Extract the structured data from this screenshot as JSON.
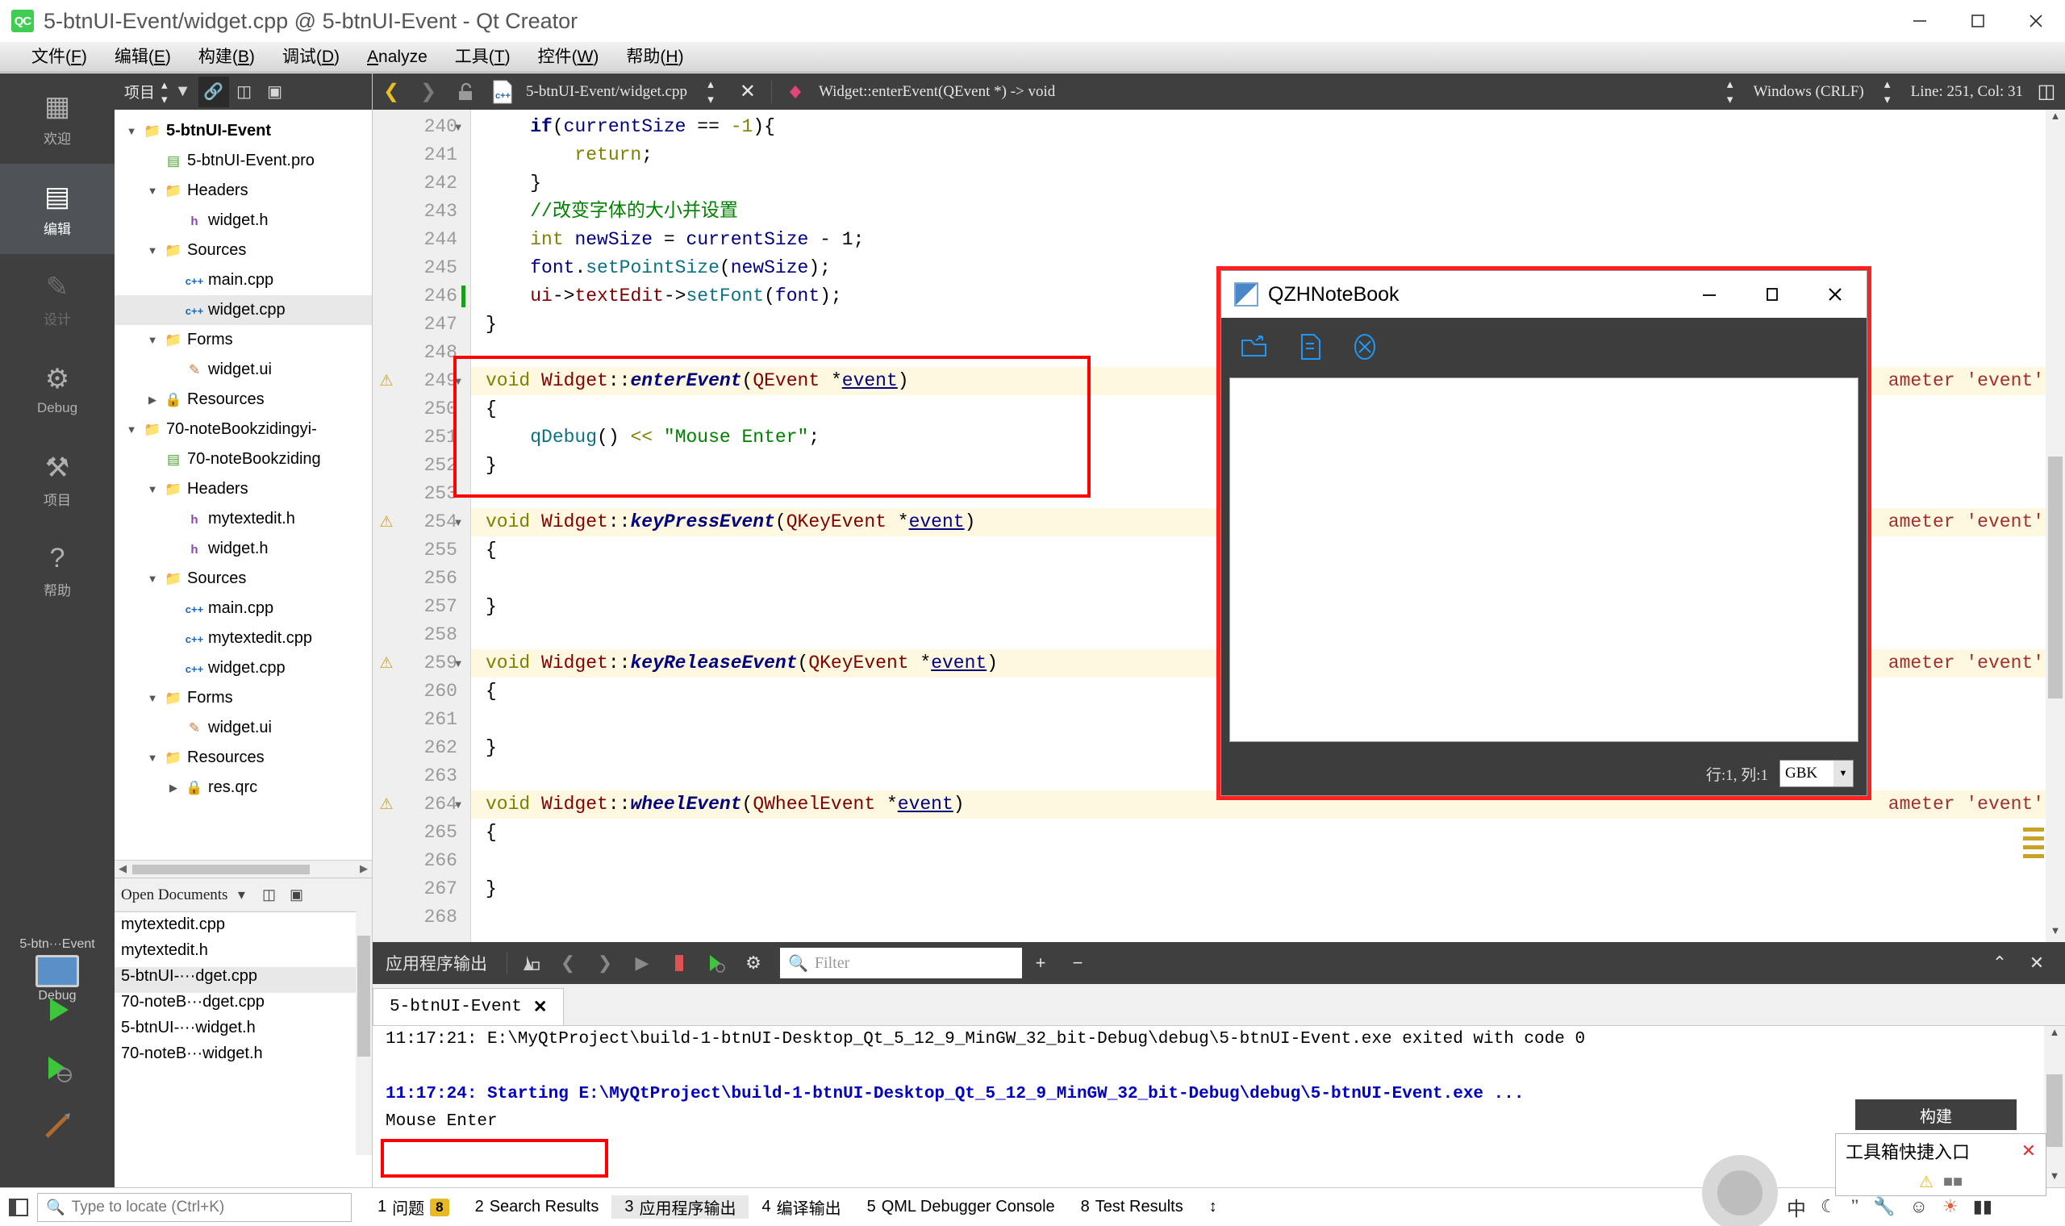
{
  "window": {
    "title": "5-btnUI-Event/widget.cpp @ 5-btnUI-Event - Qt Creator",
    "icon_text": "QC",
    "minimize": "—",
    "maximize": "❐",
    "close": "✕"
  },
  "menubar": {
    "items": [
      {
        "label": "文件(F)"
      },
      {
        "label": "编辑(E)"
      },
      {
        "label": "构建(B)"
      },
      {
        "label": "调试(D)"
      },
      {
        "label": "Analyze"
      },
      {
        "label": "工具(T)"
      },
      {
        "label": "控件(W)"
      },
      {
        "label": "帮助(H)"
      }
    ]
  },
  "modebar": {
    "items": [
      {
        "label": "欢迎",
        "icon": "grid-icon",
        "glyph": "▦",
        "active": false,
        "dim": false
      },
      {
        "label": "编辑",
        "icon": "document-icon",
        "glyph": "▤",
        "active": true,
        "dim": false
      },
      {
        "label": "设计",
        "icon": "pencil-icon",
        "glyph": "✎",
        "active": false,
        "dim": true
      },
      {
        "label": "Debug",
        "icon": "bug-icon",
        "glyph": "⚙",
        "active": false,
        "dim": false
      },
      {
        "label": "项目",
        "icon": "wrench-icon",
        "glyph": "⚒",
        "active": false,
        "dim": false
      },
      {
        "label": "帮助",
        "icon": "help-icon",
        "glyph": "?",
        "active": false,
        "dim": false
      }
    ],
    "kit": {
      "name": "5-btn···Event",
      "config": "Debug"
    }
  },
  "project_pane": {
    "toolbar": {
      "combo_label": "项目",
      "filter_icon": "filter-icon",
      "link_icon": "link-icon",
      "split_icon": "split-icon",
      "collapse_icon": "collapse-icon"
    },
    "tree": [
      {
        "depth": 0,
        "arrow": "▼",
        "icon": "📁",
        "label": "5-btnUI-Event",
        "bold": true,
        "selected": false
      },
      {
        "depth": 1,
        "arrow": "",
        "icon": "▤",
        "label": "5-btnUI-Event.pro",
        "bold": false,
        "selected": false
      },
      {
        "depth": 1,
        "arrow": "▼",
        "icon": "📁",
        "label": "Headers",
        "bold": false,
        "selected": false
      },
      {
        "depth": 2,
        "arrow": "",
        "icon": "h",
        "label": "widget.h",
        "bold": false,
        "selected": false
      },
      {
        "depth": 1,
        "arrow": "▼",
        "icon": "📁",
        "label": "Sources",
        "bold": false,
        "selected": false
      },
      {
        "depth": 2,
        "arrow": "",
        "icon": "c++",
        "label": "main.cpp",
        "bold": false,
        "selected": false
      },
      {
        "depth": 2,
        "arrow": "",
        "icon": "c++",
        "label": "widget.cpp",
        "bold": false,
        "selected": true
      },
      {
        "depth": 1,
        "arrow": "▼",
        "icon": "📁",
        "label": "Forms",
        "bold": false,
        "selected": false
      },
      {
        "depth": 2,
        "arrow": "",
        "icon": "✎",
        "label": "widget.ui",
        "bold": false,
        "selected": false
      },
      {
        "depth": 1,
        "arrow": "▶",
        "icon": "🔒",
        "label": "Resources",
        "bold": false,
        "selected": false
      },
      {
        "depth": 0,
        "arrow": "▼",
        "icon": "📁",
        "label": "70-noteBookzidingyi-",
        "bold": false,
        "selected": false
      },
      {
        "depth": 1,
        "arrow": "",
        "icon": "▤",
        "label": "70-noteBookziding",
        "bold": false,
        "selected": false
      },
      {
        "depth": 1,
        "arrow": "▼",
        "icon": "📁",
        "label": "Headers",
        "bold": false,
        "selected": false
      },
      {
        "depth": 2,
        "arrow": "",
        "icon": "h",
        "label": "mytextedit.h",
        "bold": false,
        "selected": false
      },
      {
        "depth": 2,
        "arrow": "",
        "icon": "h",
        "label": "widget.h",
        "bold": false,
        "selected": false
      },
      {
        "depth": 1,
        "arrow": "▼",
        "icon": "📁",
        "label": "Sources",
        "bold": false,
        "selected": false
      },
      {
        "depth": 2,
        "arrow": "",
        "icon": "c++",
        "label": "main.cpp",
        "bold": false,
        "selected": false
      },
      {
        "depth": 2,
        "arrow": "",
        "icon": "c++",
        "label": "mytextedit.cpp",
        "bold": false,
        "selected": false
      },
      {
        "depth": 2,
        "arrow": "",
        "icon": "c++",
        "label": "widget.cpp",
        "bold": false,
        "selected": false
      },
      {
        "depth": 1,
        "arrow": "▼",
        "icon": "📁",
        "label": "Forms",
        "bold": false,
        "selected": false
      },
      {
        "depth": 2,
        "arrow": "",
        "icon": "✎",
        "label": "widget.ui",
        "bold": false,
        "selected": false
      },
      {
        "depth": 1,
        "arrow": "▼",
        "icon": "📁",
        "label": "Resources",
        "bold": false,
        "selected": false
      },
      {
        "depth": 2,
        "arrow": "▶",
        "icon": "🔒",
        "label": "res.qrc",
        "bold": false,
        "selected": false
      }
    ],
    "open_documents": {
      "title": "Open Documents",
      "items": [
        {
          "label": "mytextedit.cpp",
          "selected": false
        },
        {
          "label": "mytextedit.h",
          "selected": false
        },
        {
          "label": "5-btnUI-···dget.cpp",
          "selected": true
        },
        {
          "label": "70-noteB···dget.cpp",
          "selected": false
        },
        {
          "label": "5-btnUI-···widget.h",
          "selected": false
        },
        {
          "label": "70-noteB···widget.h",
          "selected": false
        }
      ]
    }
  },
  "editor_toolbar": {
    "back_icon": "chevron-left-icon",
    "forward_icon": "chevron-right-icon",
    "lock_icon": "unlock-icon",
    "file_icon": "cpp-file-icon",
    "file_path": "5-btnUI-Event/widget.cpp",
    "close_icon": "close-icon",
    "symbol_icon": "method-icon",
    "symbol": "Widget::enterEvent(QEvent *) -> void",
    "line_ending": "Windows (CRLF)",
    "cursor_position": "Line: 251, Col: 31",
    "split_icon": "split-editor-icon"
  },
  "code": {
    "lines": [
      {
        "num": "240",
        "fold": "▼",
        "warn": false,
        "html": "    <span class=\"kw2\">if</span><span class=\"plain\">(</span><span class=\"var\">currentSize</span> <span class=\"plain\">==</span> <span class=\"kw\">-1</span><span class=\"plain\">){</span>"
      },
      {
        "num": "241",
        "fold": "",
        "warn": false,
        "html": "        <span class=\"kw\">return</span><span class=\"plain\">;</span>"
      },
      {
        "num": "242",
        "fold": "",
        "warn": false,
        "html": "    <span class=\"plain\">}</span>"
      },
      {
        "num": "243",
        "fold": "",
        "warn": false,
        "html": "    <span class=\"cmt\">//改变字体的大小并设置</span>"
      },
      {
        "num": "244",
        "fold": "",
        "warn": false,
        "html": "    <span class=\"kw\">int</span> <span class=\"var\">newSize</span> <span class=\"plain\">=</span> <span class=\"var\">currentSize</span> <span class=\"plain\">- 1;</span>"
      },
      {
        "num": "245",
        "fold": "",
        "warn": false,
        "html": "    <span class=\"var\">font</span><span class=\"plain\">.</span><span class=\"mem\">setPointSize</span><span class=\"plain\">(</span><span class=\"var\">newSize</span><span class=\"plain\">);</span>"
      },
      {
        "num": "246",
        "fold": "",
        "warn": false,
        "html": "    <span class=\"hlred\">ui</span><span class=\"plain\">-&gt;</span><span class=\"hlred\">textEdit</span><span class=\"plain\">-&gt;</span><span class=\"mem\">setFont</span><span class=\"plain\">(</span><span class=\"var\">font</span><span class=\"plain\">);</span>"
      },
      {
        "num": "247",
        "fold": "",
        "warn": false,
        "html": "<span class=\"plain\">}</span>"
      },
      {
        "num": "248",
        "fold": "",
        "warn": false,
        "html": ""
      },
      {
        "num": "249",
        "fold": "▼",
        "warn": true,
        "html": "<span class=\"kw\">void</span> <span class=\"cls\">Widget</span><span class=\"plain\">::</span><span class=\"fn\">enterEvent</span><span class=\"plain\">(</span><span class=\"cls\">QEvent</span> <span class=\"plain\">*</span><span class=\"var undl\">event</span><span class=\"plain\">)</span>"
      },
      {
        "num": "250",
        "fold": "",
        "warn": false,
        "html": "<span class=\"plain\">{</span>"
      },
      {
        "num": "251",
        "fold": "",
        "warn": false,
        "html": "    <span class=\"mem\">qDebug</span><span class=\"plain\">()</span> <span class=\"kw\">&lt;&lt;</span> <span class=\"str\">\"Mouse Enter\"</span><span class=\"plain\">;</span>"
      },
      {
        "num": "252",
        "fold": "",
        "warn": false,
        "html": "<span class=\"plain\">}</span>"
      },
      {
        "num": "253",
        "fold": "",
        "warn": false,
        "html": ""
      },
      {
        "num": "254",
        "fold": "▼",
        "warn": true,
        "html": "<span class=\"kw\">void</span> <span class=\"cls\">Widget</span><span class=\"plain\">::</span><span class=\"fn\">keyPressEvent</span><span class=\"plain\">(</span><span class=\"cls\">QKeyEvent</span> <span class=\"plain\">*</span><span class=\"var undl\">event</span><span class=\"plain\">)</span>"
      },
      {
        "num": "255",
        "fold": "",
        "warn": false,
        "html": "<span class=\"plain\">{</span>"
      },
      {
        "num": "256",
        "fold": "",
        "warn": false,
        "html": ""
      },
      {
        "num": "257",
        "fold": "",
        "warn": false,
        "html": "<span class=\"plain\">}</span>"
      },
      {
        "num": "258",
        "fold": "",
        "warn": false,
        "html": ""
      },
      {
        "num": "259",
        "fold": "▼",
        "warn": true,
        "html": "<span class=\"kw\">void</span> <span class=\"cls\">Widget</span><span class=\"plain\">::</span><span class=\"fn\">keyReleaseEvent</span><span class=\"plain\">(</span><span class=\"cls\">QKeyEvent</span> <span class=\"plain\">*</span><span class=\"var undl\">event</span><span class=\"plain\">)</span>"
      },
      {
        "num": "260",
        "fold": "",
        "warn": false,
        "html": "<span class=\"plain\">{</span>"
      },
      {
        "num": "261",
        "fold": "",
        "warn": false,
        "html": ""
      },
      {
        "num": "262",
        "fold": "",
        "warn": false,
        "html": "<span class=\"plain\">}</span>"
      },
      {
        "num": "263",
        "fold": "",
        "warn": false,
        "html": ""
      },
      {
        "num": "264",
        "fold": "▼",
        "warn": true,
        "html": "<span class=\"kw\">void</span> <span class=\"cls\">Widget</span><span class=\"plain\">::</span><span class=\"fn\">wheelEvent</span><span class=\"plain\">(</span><span class=\"cls\">QWheelEvent</span> <span class=\"plain\">*</span><span class=\"var undl\">event</span><span class=\"plain\">)</span>"
      },
      {
        "num": "265",
        "fold": "",
        "warn": false,
        "html": "<span class=\"plain\">{</span>"
      },
      {
        "num": "266",
        "fold": "",
        "warn": false,
        "html": ""
      },
      {
        "num": "267",
        "fold": "",
        "warn": false,
        "html": "<span class=\"plain\">}</span>"
      },
      {
        "num": "268",
        "fold": "",
        "warn": false,
        "html": ""
      }
    ],
    "warning_tooltip": "ameter 'event'"
  },
  "dialog": {
    "title": "QZHNoteBook",
    "minimize": "—",
    "maximize": "❐",
    "close": "✕",
    "toolbar": [
      {
        "icon": "open-folder-icon"
      },
      {
        "icon": "new-file-icon"
      },
      {
        "icon": "close-circle-icon"
      }
    ],
    "status_text": "行:1, 列:1",
    "encoding": "GBK",
    "encoding_arrow": "▼"
  },
  "output": {
    "title": "应用程序输出",
    "icons": [
      "output-settings-icon",
      "prev-icon",
      "next-icon",
      "run-icon",
      "stop-icon",
      "rerun-icon",
      "gear-icon"
    ],
    "filter_placeholder": "Filter",
    "add_icon": "+",
    "remove_icon": "−",
    "collapse_icon": "⌃",
    "close_icon": "✕",
    "tab": {
      "label": "5-btnUI-Event",
      "close": "✕"
    },
    "lines": [
      {
        "style": "black",
        "text": "11:17:21: E:\\MyQtProject\\build-1-btnUI-Desktop_Qt_5_12_9_MinGW_32_bit-Debug\\debug\\5-btnUI-Event.exe exited with code 0"
      },
      {
        "style": "blank",
        "text": ""
      },
      {
        "style": "blue",
        "text": "11:17:24: Starting E:\\MyQtProject\\build-1-btnUI-Desktop_Qt_5_12_9_MinGW_32_bit-Debug\\debug\\5-btnUI-Event.exe ..."
      },
      {
        "style": "black",
        "text": "Mouse Enter"
      }
    ]
  },
  "statusbar": {
    "hide_sidebar_icon": "sidebar-toggle-icon",
    "locate_placeholder": "Type to locate (Ctrl+K)",
    "locate_icon": "search-icon",
    "items": [
      {
        "num": "1",
        "label": "问题",
        "badge": "8",
        "active": false
      },
      {
        "num": "2",
        "label": "Search Results",
        "badge": "",
        "active": false
      },
      {
        "num": "3",
        "label": "应用程序输出",
        "badge": "",
        "active": true
      },
      {
        "num": "4",
        "label": "编译输出",
        "badge": "",
        "active": false
      },
      {
        "num": "5",
        "label": "QML Debugger Console",
        "badge": "",
        "active": false
      },
      {
        "num": "8",
        "label": "Test Results",
        "badge": "",
        "active": false
      }
    ],
    "updown_icon": "↕"
  },
  "overlays": {
    "build_tooltip": "构建",
    "toolbox_title": "工具箱快捷入口",
    "toolbox_close": "✕",
    "ime_lang": "中",
    "ime_icons": [
      "moon-icon",
      "comma-icon",
      "smiley-icon",
      "wrench-icon",
      "face-icon",
      "color-icon",
      "keyboard-icon"
    ]
  },
  "colors": {
    "accent_red": "#ff0000",
    "dark_chrome": "#3f3f3f",
    "qt_green": "#41cd52",
    "warn_yellow": "#fff8e0"
  }
}
